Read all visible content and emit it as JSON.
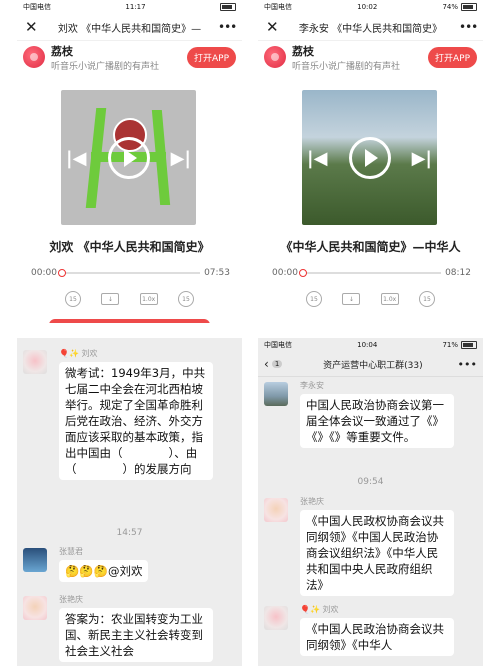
{
  "panel1": {
    "status": {
      "carrier": "中国电信",
      "time": "11:17"
    },
    "nav": {
      "close": "✕",
      "title": "刘欢 《中华人民共和国简史》—",
      "more": "•••"
    },
    "app": {
      "name": "荔枝",
      "desc": "听音乐小说广播剧的有声社",
      "open": "打开APP"
    },
    "song_title": "刘欢 《中华人民共和国简史》",
    "elapsed": "00:00",
    "duration": "07:53",
    "progress": 0.0,
    "controls": {
      "back15": "15",
      "speed": "1.0x",
      "fwd15": "15"
    }
  },
  "panel2": {
    "status": {
      "carrier": "中国电信",
      "time": "10:02",
      "battery": "74%"
    },
    "nav": {
      "close": "✕",
      "title": "李永安 《中华人民共和国简史》",
      "more": "•••"
    },
    "app": {
      "name": "荔枝",
      "desc": "听音乐小说广播剧的有声社",
      "open": "打开APP"
    },
    "song_title": "《中华人民共和国简史》—中华人",
    "elapsed": "00:00",
    "duration": "08:12",
    "progress": 0.0,
    "controls": {
      "back15": "15",
      "speed": "1.0x",
      "fwd15": "15"
    }
  },
  "panel3": {
    "messages": [
      {
        "name": "🎈✨ 刘欢",
        "text": "微考试：1949年3月，中共七届二中全会在河北西柏坡举行。规定了全国革命胜利后党在政治、经济、外交方面应该采取的基本政策，指出中国由（　　　　）、由（　　　　）的发展方向"
      },
      {
        "name": "张慧君",
        "text": "🤔🤔🤔@刘欢"
      },
      {
        "name": "张艳庆",
        "text": "答案为：农业国转变为工业国、新民主主义社会转变到社会主义社会"
      }
    ],
    "timestamp": "14:57"
  },
  "panel4": {
    "status": {
      "carrier": "中国电信",
      "time": "10:04",
      "battery": "71%"
    },
    "header": {
      "back": "‹",
      "badge": "1",
      "title": "资产运营中心职工群(33)",
      "more": "•••"
    },
    "messages": [
      {
        "name": "李永安",
        "text": "中国人民政治协商会议第一届全体会议一致通过了《》《》《》等重要文件。"
      },
      {
        "name": "张艳庆",
        "text": "《中国人民政权协商会议共同纲领》《中国人民政治协商会议组织法》《中华人民共和国中央人民政府组织法》"
      },
      {
        "name": "🎈✨ 刘欢",
        "text": "《中国人民政治协商会议共同纲领》《中华人"
      }
    ],
    "timestamp": "09:54"
  }
}
